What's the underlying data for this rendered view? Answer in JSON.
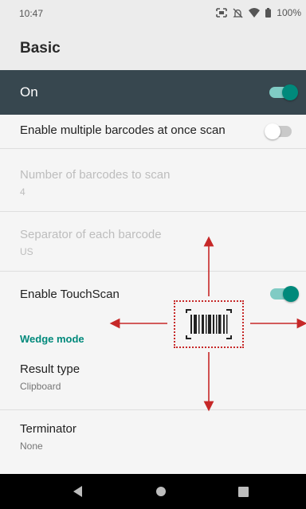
{
  "status_bar": {
    "time": "10:47",
    "battery": "100%",
    "icons": [
      "screenshot-icon",
      "mute-icon",
      "wifi-icon",
      "battery-icon"
    ]
  },
  "header": {
    "title": "Basic"
  },
  "master_switch": {
    "label": "On",
    "checked": true
  },
  "settings": {
    "multi_barcode": {
      "label": "Enable multiple barcodes at once scan",
      "checked": false
    },
    "number_of_barcodes": {
      "label": "Number of barcodes to scan",
      "value": "4",
      "enabled": false
    },
    "separator": {
      "label": "Separator of each barcode",
      "value": "US",
      "enabled": false
    },
    "touch_scan": {
      "label": "Enable TouchScan",
      "checked": true
    }
  },
  "wedge_section": {
    "header": "Wedge mode",
    "result_type": {
      "label": "Result type",
      "value": "Clipboard"
    },
    "terminator": {
      "label": "Terminator",
      "value": "None"
    }
  },
  "nav_bar": {
    "buttons": [
      "back-icon",
      "home-icon",
      "recents-icon"
    ]
  },
  "colors": {
    "accent": "#00897b",
    "header_dark": "#37474f",
    "annotation_red": "#c62828"
  },
  "overlay": {
    "icon": "barcode-icon",
    "arrows": [
      "arrow-up-icon",
      "arrow-down-icon",
      "arrow-left-icon",
      "arrow-right-icon"
    ]
  }
}
